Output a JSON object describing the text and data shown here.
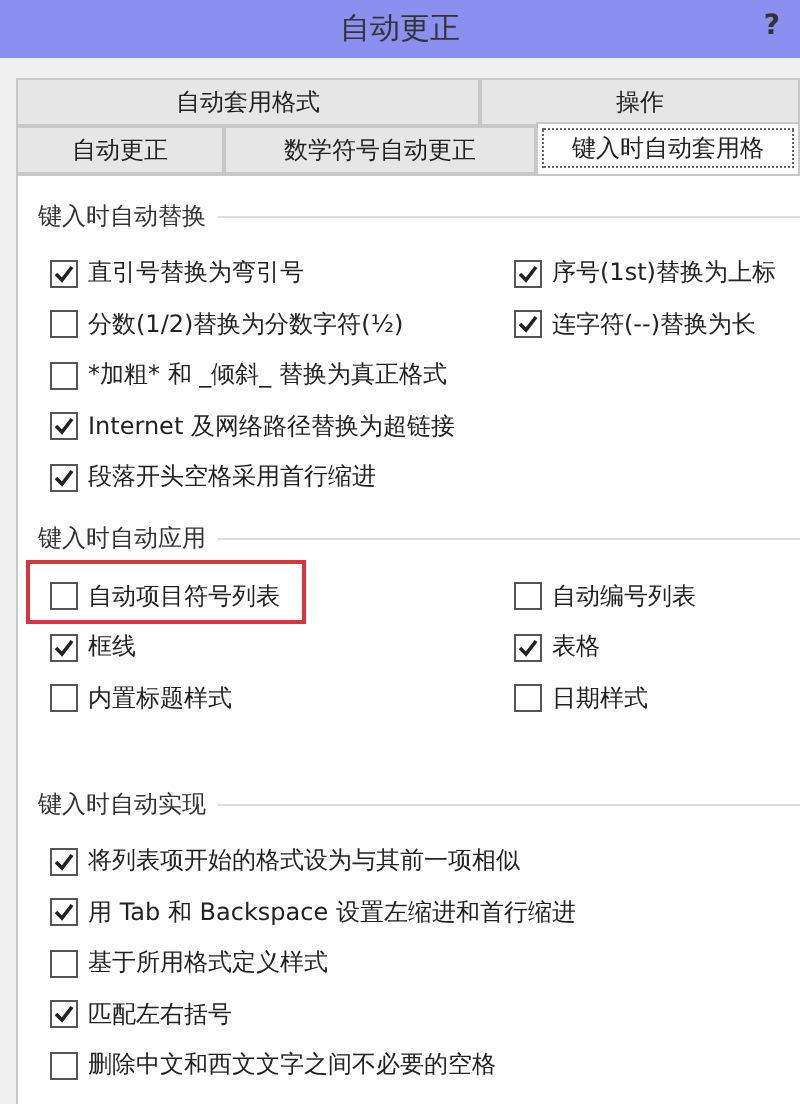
{
  "window": {
    "title": "自动更正",
    "help": "?"
  },
  "tab_rows": [
    [
      {
        "label": "自动套用格式",
        "selected": false
      },
      {
        "label": "操作",
        "selected": false
      }
    ],
    [
      {
        "label": "自动更正",
        "selected": false
      },
      {
        "label": "数学符号自动更正",
        "selected": false
      },
      {
        "label": "键入时自动套用格",
        "selected": true
      }
    ]
  ],
  "sections": [
    {
      "title": "键入时自动替换",
      "rows": [
        [
          {
            "label": "直引号替换为弯引号",
            "checked": true,
            "highlighted": false
          },
          {
            "label": "序号(1st)替换为上标",
            "checked": true,
            "highlighted": false
          }
        ],
        [
          {
            "label": "分数(1/2)替换为分数字符(½)",
            "checked": false,
            "highlighted": false
          },
          {
            "label": "连字符(--)替换为长",
            "checked": true,
            "highlighted": false
          }
        ],
        [
          {
            "label": "*加粗* 和 _倾斜_ 替换为真正格式",
            "checked": false,
            "highlighted": false
          }
        ],
        [
          {
            "label": "Internet 及网络路径替换为超链接",
            "checked": true,
            "highlighted": false
          }
        ],
        [
          {
            "label": "段落开头空格采用首行缩进",
            "checked": true,
            "highlighted": false
          }
        ]
      ]
    },
    {
      "title": "键入时自动应用",
      "rows": [
        [
          {
            "label": "自动项目符号列表",
            "checked": false,
            "highlighted": true
          },
          {
            "label": "自动编号列表",
            "checked": false,
            "highlighted": false
          }
        ],
        [
          {
            "label": "框线",
            "checked": true,
            "highlighted": false
          },
          {
            "label": "表格",
            "checked": true,
            "highlighted": false
          }
        ],
        [
          {
            "label": "内置标题样式",
            "checked": false,
            "highlighted": false
          },
          {
            "label": "日期样式",
            "checked": false,
            "highlighted": false
          }
        ]
      ]
    },
    {
      "title": "键入时自动实现",
      "rows": [
        [
          {
            "label": "将列表项开始的格式设为与其前一项相似",
            "checked": true,
            "highlighted": false
          }
        ],
        [
          {
            "label": "用 Tab 和 Backspace 设置左缩进和首行缩进",
            "checked": true,
            "highlighted": false
          }
        ],
        [
          {
            "label": "基于所用格式定义样式",
            "checked": false,
            "highlighted": false
          }
        ],
        [
          {
            "label": "匹配左右括号",
            "checked": true,
            "highlighted": false
          }
        ],
        [
          {
            "label": "删除中文和西文文字之间不必要的空格",
            "checked": false,
            "highlighted": false
          }
        ]
      ]
    }
  ]
}
